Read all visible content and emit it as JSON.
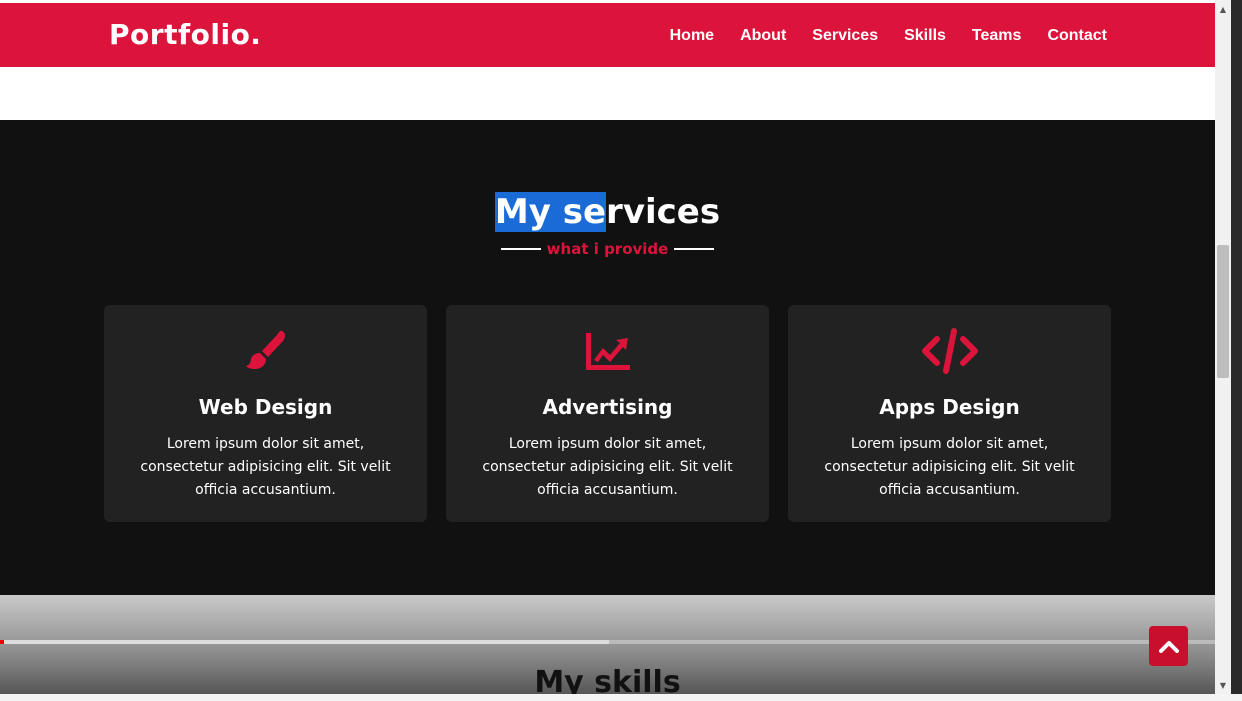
{
  "navbar": {
    "logo": "Portfolio.",
    "menu": [
      "Home",
      "About",
      "Services",
      "Skills",
      "Teams",
      "Contact"
    ],
    "bg_color": "#dc143c"
  },
  "services": {
    "title_selected": "My se",
    "title_rest": "rvices",
    "subtitle": "what i provide",
    "cards": [
      {
        "icon": "paint-brush-icon",
        "title": "Web Design",
        "text": "Lorem ipsum dolor sit amet, consectetur adipisicing elit. Sit velit officia accusantium."
      },
      {
        "icon": "chart-line-icon",
        "title": "Advertising",
        "text": "Lorem ipsum dolor sit amet, consectetur adipisicing elit. Sit velit officia accusantium."
      },
      {
        "icon": "code-icon",
        "title": "Apps Design",
        "text": "Lorem ipsum dolor sit amet, consectetur adipisicing elit. Sit velit officia accusantium."
      }
    ]
  },
  "skills": {
    "title": "My skills"
  },
  "video_progress": 0.49,
  "colors": {
    "accent": "#dc143c",
    "section_bg": "#111111",
    "card_bg": "#222222"
  }
}
